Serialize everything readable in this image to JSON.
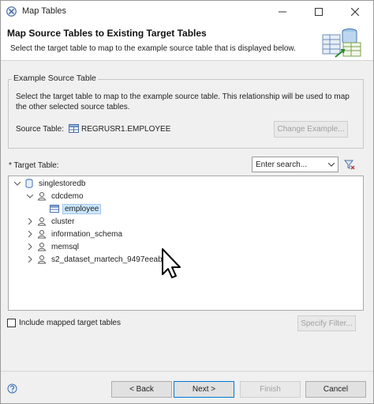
{
  "window": {
    "title": "Map Tables"
  },
  "header": {
    "title": "Map Source Tables to Existing Target Tables",
    "subtitle": "Select the target table to map to the example source table that is displayed below."
  },
  "example_group": {
    "legend": "Example Source Table",
    "description": "Select the target table to map to the example source table. This relationship will be used to map the other selected source tables.",
    "source_label": "Source Table:",
    "source_value": "REGRUSR1.EMPLOYEE",
    "change_button": "Change Example..."
  },
  "target": {
    "label": "* Target Table:",
    "search_placeholder": "Enter search...",
    "tree": [
      {
        "label": "singlestoredb",
        "icon": "database-icon",
        "twisty": "expanded"
      },
      {
        "label": "cdcdemo",
        "icon": "schema-user-icon",
        "twisty": "expanded"
      },
      {
        "label": "employee",
        "icon": "table-icon",
        "twisty": "none",
        "selected": true
      },
      {
        "label": "cluster",
        "icon": "schema-user-icon",
        "twisty": "collapsed"
      },
      {
        "label": "information_schema",
        "icon": "schema-user-icon",
        "twisty": "collapsed"
      },
      {
        "label": "memsql",
        "icon": "schema-user-icon",
        "twisty": "collapsed"
      },
      {
        "label": "s2_dataset_martech_9497eeab",
        "icon": "schema-user-icon",
        "twisty": "collapsed"
      }
    ]
  },
  "options": {
    "include_mapped_label": "Include mapped target tables",
    "include_mapped_checked": false,
    "specify_filter_button": "Specify Filter..."
  },
  "footer": {
    "back": "< Back",
    "next": "Next >",
    "finish": "Finish",
    "cancel": "Cancel"
  },
  "colors": {
    "selection": "#cce8ff",
    "accent": "#0078d7",
    "dialog_bg": "#f0f0f0"
  }
}
